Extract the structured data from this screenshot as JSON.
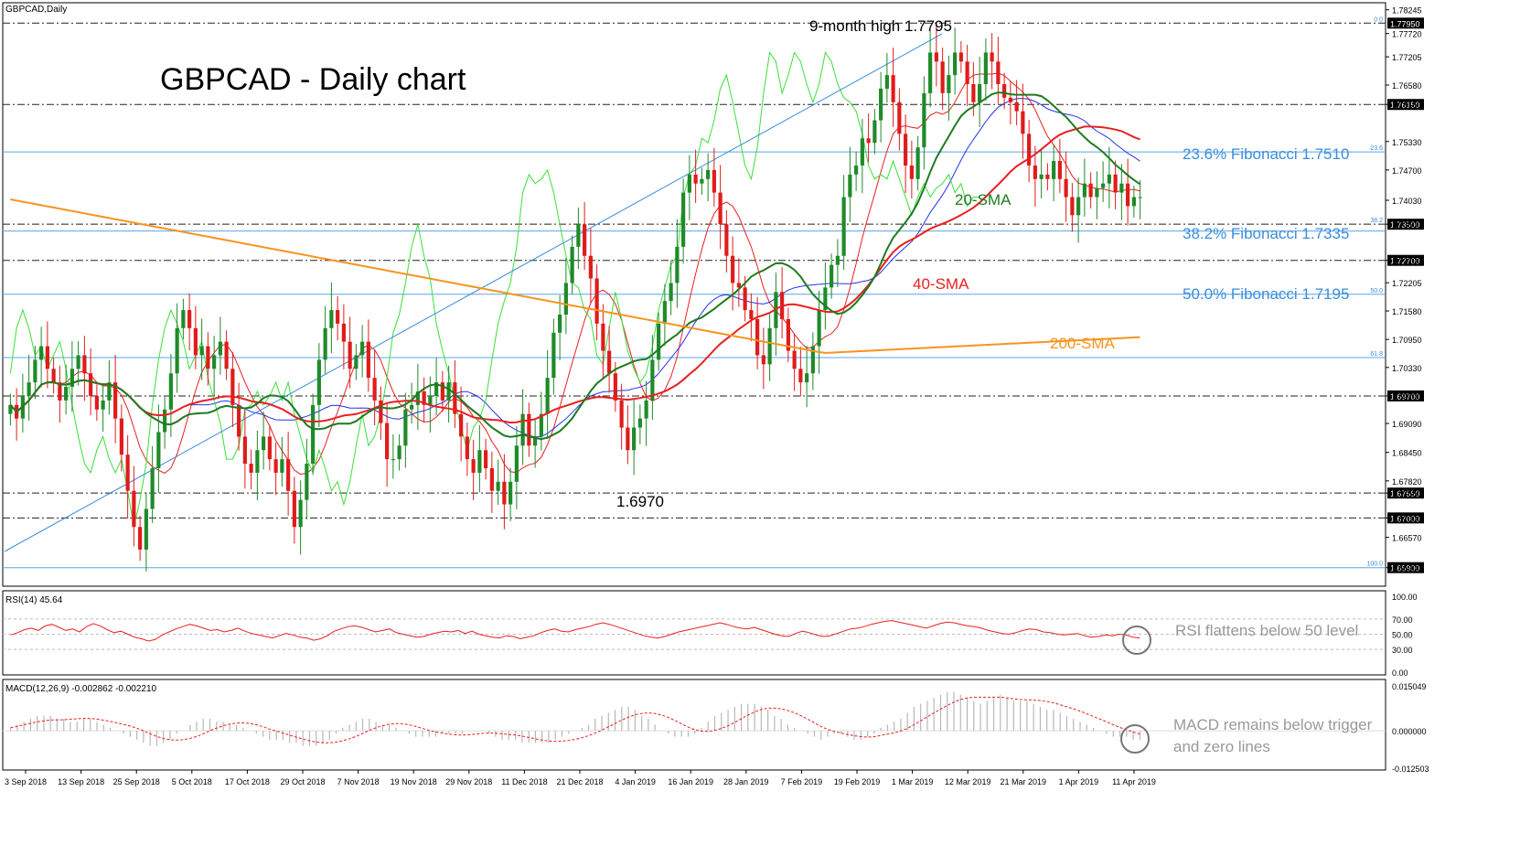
{
  "chart_data": [
    {
      "type": "candlestick",
      "panel": "price",
      "symbol_label": "GBPCAD,Daily",
      "title": "GBPCAD - Daily chart",
      "ylim": [
        1.6555,
        1.783
      ],
      "y_ticks": [
        "1.78245",
        "1.77720",
        "1.77205",
        "1.76580",
        "1.76150",
        "1.75330",
        "1.74700",
        "1.74030",
        "1.73500",
        "1.72700",
        "1.72205",
        "1.71580",
        "1.70950",
        "1.70330",
        "1.69700",
        "1.69090",
        "1.68450",
        "1.67820",
        "1.67550",
        "1.67000",
        "1.66570",
        "1.65900"
      ],
      "x_ticks": [
        "3 Sep 2018",
        "13 Sep 2018",
        "25 Sep 2018",
        "5 Oct 2018",
        "17 Oct 2018",
        "29 Oct 2018",
        "7 Nov 2018",
        "19 Nov 2018",
        "29 Nov 2018",
        "11 Dec 2018",
        "21 Dec 2018",
        "4 Jan 2019",
        "16 Jan 2019",
        "28 Jan 2019",
        "7 Feb 2019",
        "19 Feb 2019",
        "1 Mar 2019",
        "12 Mar 2019",
        "21 Mar 2019",
        "1 Apr 2019",
        "11 Apr 2019"
      ],
      "horizontal_levels": [
        {
          "value": 1.7795,
          "tag": "1.77950",
          "fib": "0.0",
          "style": "dashdot"
        },
        {
          "value": 1.7615,
          "tag": "1.76150",
          "style": "dashdot"
        },
        {
          "value": 1.751,
          "fib": "23.6",
          "style": "solid-blue"
        },
        {
          "value": 1.735,
          "tag": "1.73500",
          "fib": "38.2",
          "style": "dashdot"
        },
        {
          "value": 1.7335,
          "style": "solid-blue"
        },
        {
          "value": 1.727,
          "tag": "1.72700",
          "style": "dashdot"
        },
        {
          "value": 1.7195,
          "fib": "50.0",
          "style": "solid-blue"
        },
        {
          "value": 1.7055,
          "fib": "61.8",
          "style": "solid-blue"
        },
        {
          "value": 1.697,
          "tag": "1.69700",
          "style": "dashdot"
        },
        {
          "value": 1.6755,
          "tag": "1.67550",
          "style": "dashdot"
        },
        {
          "value": 1.67,
          "tag": "1.67000",
          "style": "dashdot"
        },
        {
          "value": 1.659,
          "tag": "1.65900",
          "fib": "100.0",
          "style": "solid-blue"
        }
      ],
      "annotations": [
        "9-month high 1.7795",
        "23.6% Fibonacci 1.7510",
        "38.2% Fibonacci 1.7335",
        "50.0% Fibonacci 1.7195",
        "20-SMA",
        "40-SMA",
        "200-SMA",
        "1.6970"
      ],
      "series": [
        {
          "name": "20-SMA",
          "color": "#1f7a1f"
        },
        {
          "name": "40-SMA",
          "color": "#e82020"
        },
        {
          "name": "200-SMA",
          "color": "#f7931e"
        }
      ],
      "closes": [
        1.695,
        1.692,
        1.697,
        1.7,
        1.705,
        1.708,
        1.703,
        1.7,
        1.696,
        1.699,
        1.703,
        1.706,
        1.702,
        1.697,
        1.694,
        1.696,
        1.7,
        1.692,
        1.684,
        1.676,
        1.668,
        1.663,
        1.672,
        1.681,
        1.689,
        1.694,
        1.702,
        1.712,
        1.716,
        1.712,
        1.706,
        1.708,
        1.703,
        1.706,
        1.709,
        1.703,
        1.695,
        1.688,
        1.682,
        1.68,
        1.685,
        1.688,
        1.683,
        1.68,
        1.683,
        1.676,
        1.668,
        1.674,
        1.682,
        1.695,
        1.705,
        1.712,
        1.716,
        1.713,
        1.709,
        1.703,
        1.706,
        1.709,
        1.701,
        1.696,
        1.691,
        1.683,
        1.683,
        1.686,
        1.694,
        1.695,
        1.698,
        1.695,
        1.697,
        1.7,
        1.696,
        1.7,
        1.693,
        1.688,
        1.683,
        1.68,
        1.685,
        1.681,
        1.676,
        1.678,
        1.673,
        1.678,
        1.686,
        1.693,
        1.686,
        1.688,
        1.693,
        1.701,
        1.711,
        1.715,
        1.722,
        1.73,
        1.735,
        1.728,
        1.723,
        1.713,
        1.707,
        1.702,
        1.696,
        1.69,
        1.685,
        1.69,
        1.692,
        1.696,
        1.705,
        1.713,
        1.718,
        1.722,
        1.73,
        1.742,
        1.746,
        1.744,
        1.745,
        1.747,
        1.742,
        1.735,
        1.728,
        1.722,
        1.721,
        1.716,
        1.714,
        1.706,
        1.704,
        1.712,
        1.72,
        1.714,
        1.707,
        1.703,
        1.7,
        1.702,
        1.708,
        1.716,
        1.721,
        1.726,
        1.728,
        1.741,
        1.746,
        1.748,
        1.754,
        1.753,
        1.758,
        1.765,
        1.768,
        1.762,
        1.755,
        1.748,
        1.745,
        1.752,
        1.764,
        1.773,
        1.771,
        1.764,
        1.768,
        1.773,
        1.771,
        1.766,
        1.762,
        1.766,
        1.773,
        1.771,
        1.766,
        1.763,
        1.762,
        1.76,
        1.755,
        1.748,
        1.745,
        1.746,
        1.745,
        1.749,
        1.745,
        1.741,
        1.737,
        1.741,
        1.744,
        1.741,
        1.743,
        1.744,
        1.746,
        1.742,
        1.744,
        1.739,
        1.741,
        1.741
      ]
    },
    {
      "type": "line",
      "panel": "rsi",
      "label": "RSI(14) 45.64",
      "y_ticks": [
        "100.00",
        "70.00",
        "50.00",
        "30.00",
        "0.00"
      ],
      "ylim": [
        0,
        100
      ],
      "levels": [
        70,
        50,
        30
      ],
      "series": [
        {
          "name": "RSI",
          "color": "#e82020",
          "values": [
            49,
            52,
            56,
            58,
            55,
            61,
            63,
            59,
            55,
            57,
            53,
            60,
            64,
            61,
            56,
            52,
            54,
            50,
            46,
            44,
            41,
            43,
            49,
            53,
            57,
            60,
            63,
            61,
            58,
            55,
            56,
            53,
            55,
            58,
            54,
            51,
            49,
            47,
            45,
            48,
            51,
            49,
            46,
            45,
            42,
            44,
            48,
            54,
            57,
            60,
            61,
            59,
            56,
            53,
            55,
            57,
            52,
            50,
            48,
            46,
            47,
            50,
            52,
            54,
            53,
            55,
            51,
            54,
            50,
            48,
            46,
            45,
            48,
            47,
            44,
            46,
            48,
            52,
            55,
            57,
            54,
            53,
            56,
            58,
            60,
            63,
            65,
            63,
            60,
            57,
            54,
            51,
            48,
            46,
            45,
            47,
            50,
            53,
            55,
            57,
            59,
            61,
            63,
            65,
            63,
            60,
            58,
            57,
            59,
            56,
            53,
            50,
            48,
            47,
            51,
            54,
            52,
            49,
            47,
            48,
            51,
            54,
            57,
            58,
            60,
            63,
            65,
            67,
            68,
            66,
            64,
            62,
            60,
            58,
            61,
            64,
            66,
            65,
            63,
            61,
            60,
            58,
            55,
            53,
            51,
            50,
            52,
            55,
            57,
            56,
            53,
            52,
            50,
            49,
            50,
            51,
            48,
            46,
            47,
            49,
            48,
            50,
            49,
            46,
            45
          ]
        }
      ],
      "annotation": "RSI flattens below 50 level"
    },
    {
      "type": "histogram",
      "panel": "macd",
      "label": "MACD(12,26,9) -0.002862 -0.002210",
      "y_ticks": [
        "0.015049",
        "0.000000",
        "-0.012503"
      ],
      "ylim": [
        -0.0125,
        0.015
      ],
      "histogram": [
        0.001,
        0.002,
        0.003,
        0.004,
        0.005,
        0.005,
        0.005,
        0.004,
        0.004,
        0.003,
        0.003,
        0.004,
        0.004,
        0.003,
        0.002,
        0.001,
        0.0,
        -0.001,
        -0.002,
        -0.003,
        -0.004,
        -0.005,
        -0.005,
        -0.004,
        -0.003,
        -0.001,
        0.0,
        0.002,
        0.003,
        0.004,
        0.004,
        0.003,
        0.003,
        0.002,
        0.002,
        0.001,
        0.0,
        -0.001,
        -0.002,
        -0.003,
        -0.003,
        -0.003,
        -0.004,
        -0.004,
        -0.005,
        -0.005,
        -0.005,
        -0.004,
        -0.003,
        -0.001,
        0.001,
        0.002,
        0.003,
        0.004,
        0.004,
        0.003,
        0.002,
        0.002,
        0.001,
        0.0,
        -0.001,
        -0.002,
        -0.002,
        -0.002,
        -0.002,
        -0.001,
        -0.001,
        -0.001,
        -0.001,
        0.0,
        0.0,
        0.0,
        -0.001,
        -0.002,
        -0.003,
        -0.003,
        -0.003,
        -0.004,
        -0.004,
        -0.004,
        -0.004,
        -0.004,
        -0.003,
        -0.002,
        -0.001,
        0.0,
        0.001,
        0.002,
        0.004,
        0.005,
        0.006,
        0.007,
        0.008,
        0.008,
        0.007,
        0.005,
        0.004,
        0.002,
        0.0,
        -0.001,
        -0.002,
        -0.002,
        -0.002,
        -0.001,
        0.001,
        0.003,
        0.005,
        0.006,
        0.007,
        0.008,
        0.009,
        0.009,
        0.009,
        0.008,
        0.007,
        0.005,
        0.004,
        0.002,
        0.001,
        0.0,
        -0.001,
        -0.002,
        -0.003,
        -0.002,
        -0.001,
        -0.001,
        -0.002,
        -0.003,
        -0.003,
        -0.002,
        -0.001,
        0.001,
        0.002,
        0.003,
        0.004,
        0.006,
        0.008,
        0.009,
        0.01,
        0.011,
        0.012,
        0.013,
        0.013,
        0.012,
        0.011,
        0.01,
        0.009,
        0.01,
        0.011,
        0.012,
        0.011,
        0.01,
        0.01,
        0.01,
        0.009,
        0.008,
        0.007,
        0.007,
        0.006,
        0.005,
        0.004,
        0.003,
        0.002,
        0.001,
        0.0,
        -0.001,
        -0.002,
        -0.002,
        -0.002,
        -0.003,
        -0.003
      ],
      "signal_color": "#e82020",
      "annotation": [
        "MACD remains below trigger",
        "and zero lines"
      ]
    }
  ]
}
